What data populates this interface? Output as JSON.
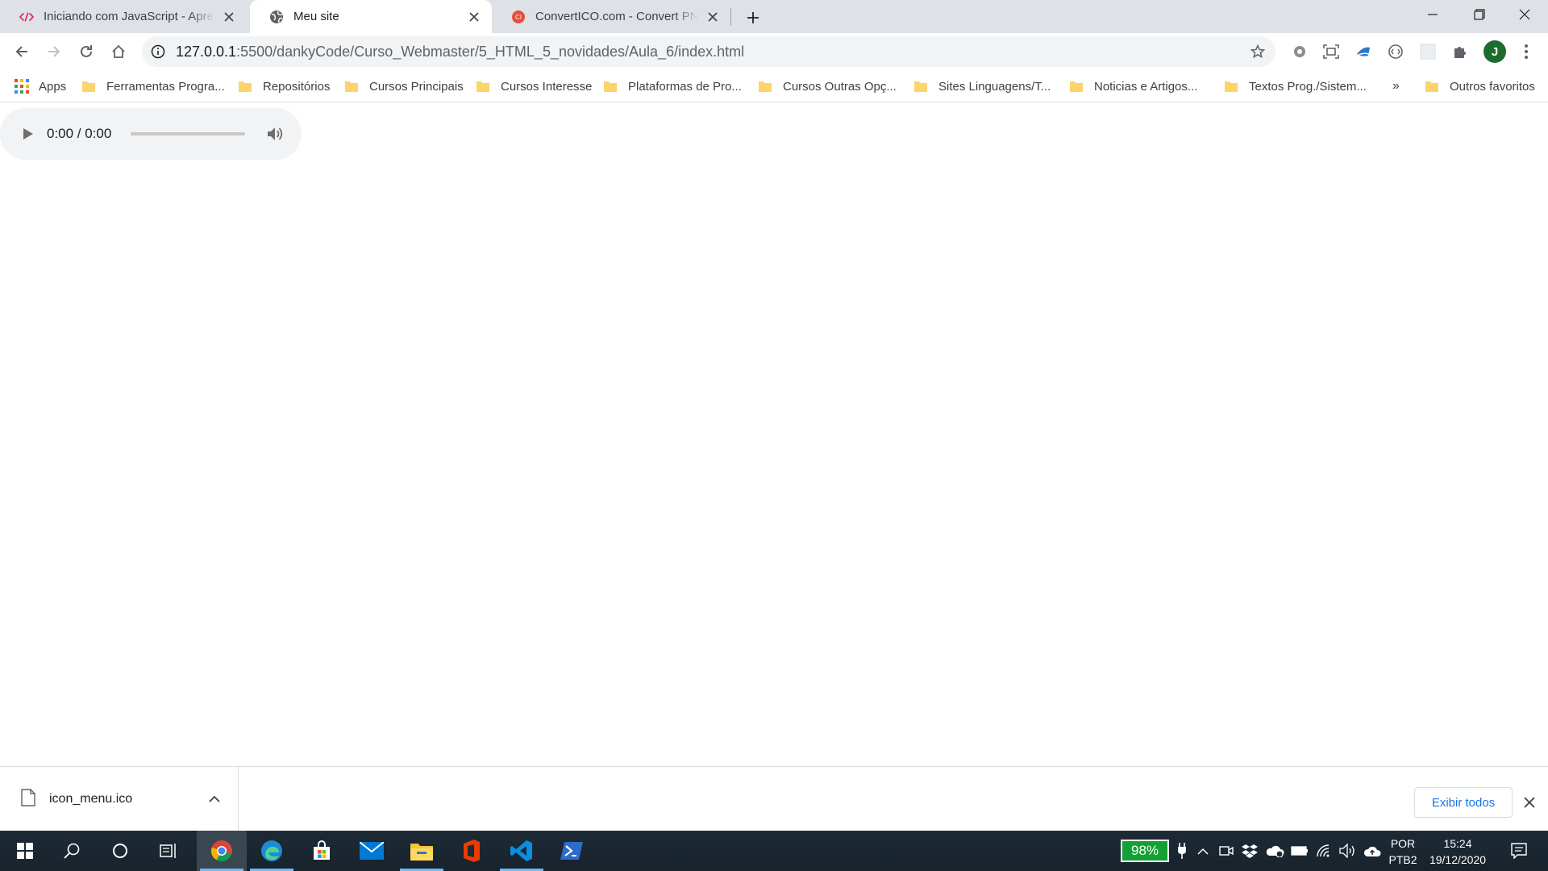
{
  "tabs": [
    {
      "title": "Iniciando com JavaScript - Apresentação",
      "favicon": "code-brackets-icon",
      "active": false
    },
    {
      "title": "Meu site",
      "favicon": "globe-icon",
      "active": true
    },
    {
      "title": "ConvertICO.com - Convert PNG to ICO",
      "favicon": "converticon-icon",
      "active": false
    }
  ],
  "address_bar": {
    "url_host": "127.0.0.1",
    "url_path": ":5500/dankyCode/Curso_Webmaster/5_HTML_5_novidades/Aula_6/index.html"
  },
  "avatar_initial": "J",
  "bookmarks": {
    "apps_label": "Apps",
    "items": [
      "Ferramentas Progra...",
      "Repositórios",
      "Cursos Principais",
      "Cursos Interesse",
      "Plataformas de Pro...",
      "Cursos Outras Opç...",
      "Sites Linguagens/T...",
      "Noticias e Artigos...",
      "Textos Prog./Sistem..."
    ],
    "overflow_label": "»",
    "other_label": "Outros favoritos"
  },
  "audio_player": {
    "time": "0:00 / 0:00"
  },
  "download_shelf": {
    "file_name": "icon_menu.ico",
    "show_all_label": "Exibir todos"
  },
  "taskbar": {
    "battery": "98%",
    "language_line1": "POR",
    "language_line2": "PTB2",
    "time": "15:24",
    "date": "19/12/2020"
  },
  "colors": {
    "tabstrip": "#dee1e6",
    "accent_blue": "#1a73e8",
    "battery_green": "#14a035",
    "taskbar": "#1d2a35"
  }
}
